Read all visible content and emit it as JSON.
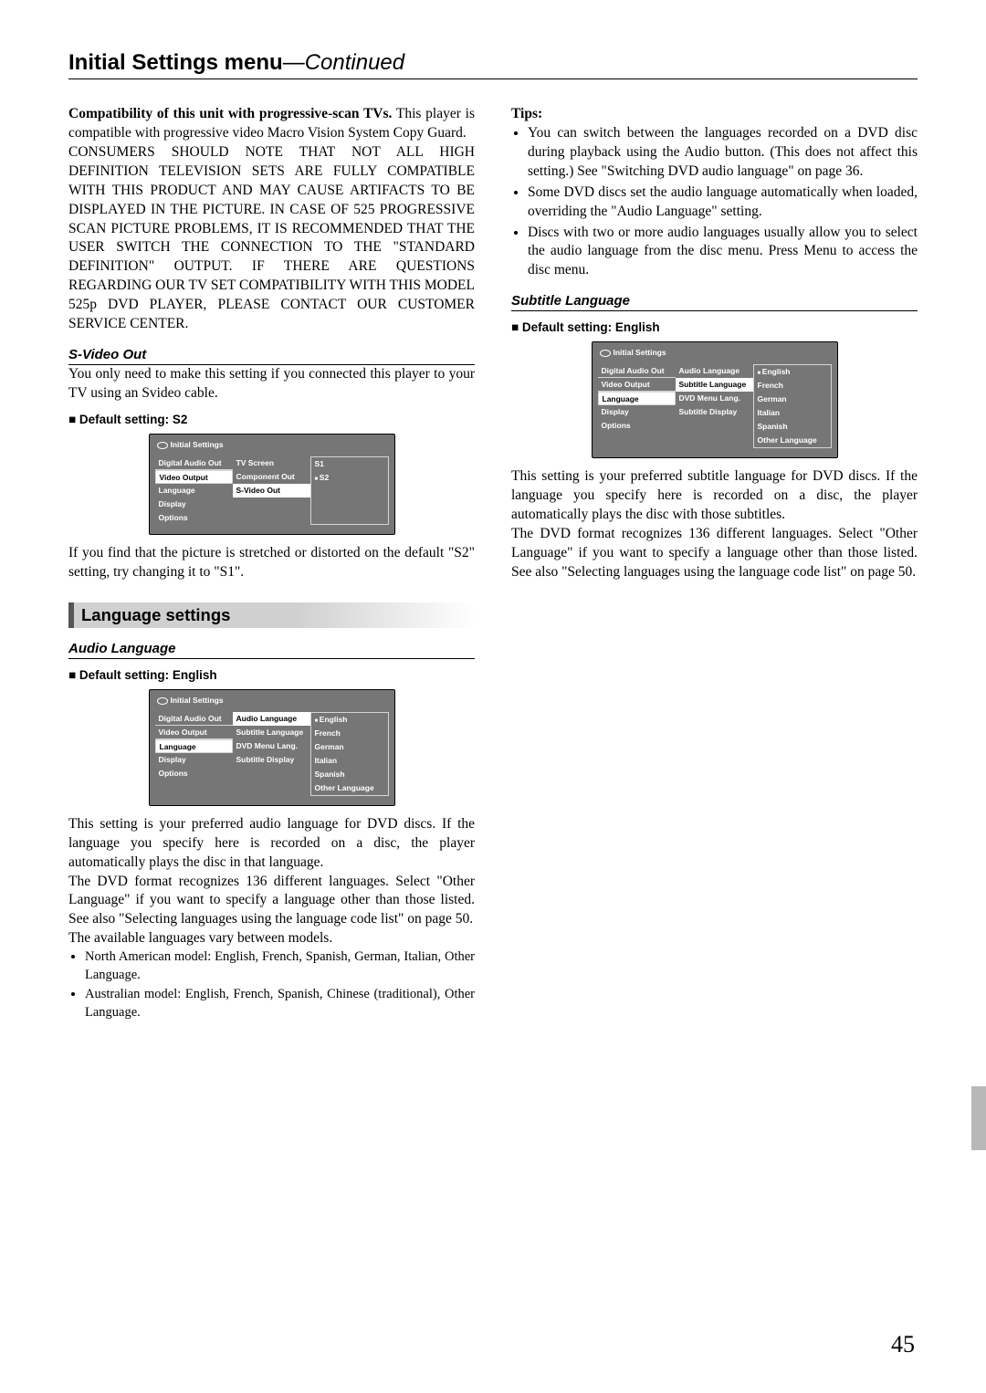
{
  "page": {
    "title_main": "Initial Settings menu",
    "title_cont": "—Continued",
    "number": "45"
  },
  "left": {
    "compat_heading": "Compatibility of this unit with progressive-scan TVs.",
    "compat_p1": "This player is compatible with progressive video Macro Vision System Copy Guard.",
    "compat_p2": "CONSUMERS SHOULD NOTE THAT NOT ALL HIGH DEFINITION TELEVISION SETS ARE FULLY COMPATIBLE WITH THIS PRODUCT AND MAY CAUSE ARTIFACTS TO BE DISPLAYED IN THE PICTURE. IN CASE OF 525 PROGRESSIVE SCAN PICTURE PROBLEMS, IT IS RECOMMENDED THAT THE USER SWITCH THE CONNECTION TO THE \"STANDARD DEFINITION\" OUTPUT. IF THERE ARE QUESTIONS REGARDING OUR TV SET COMPATIBILITY WITH THIS MODEL 525p DVD PLAYER, PLEASE CONTACT OUR CUSTOMER SERVICE CENTER.",
    "svideo": {
      "heading": "S-Video Out",
      "p1": "You only need to make this setting if you connected this player to your TV using an Svideo cable.",
      "default": "Default setting: S2",
      "p2": "If you find that the picture is stretched or distorted on the default \"S2\" setting, try changing it to \"S1\"."
    },
    "lang_section": "Language settings",
    "audio": {
      "heading": "Audio Language",
      "default": "Default setting: English",
      "p1": "This setting is your preferred audio language for DVD discs. If the language you specify here is recorded on a disc, the player automatically plays the disc in that language.",
      "p2": "The DVD format recognizes 136 different languages. Select \"Other Language\" if you want to specify a language other than those listed. See also \"Selecting languages using the language code list\" on page 50.",
      "p3": "The available languages vary between models.",
      "li1": "North American model: English, French, Spanish, German, Italian, Other Language.",
      "li2": "Australian model: English, French, Spanish, Chinese (traditional), Other Language."
    }
  },
  "right": {
    "tips_label": "Tips:",
    "tip1": "You can switch between the languages recorded on a DVD disc during playback using the Audio button. (This does not affect this setting.) See \"Switching DVD audio language\" on page 36.",
    "tip2": "Some DVD discs set the audio language automatically when loaded, overriding the \"Audio Language\" setting.",
    "tip3": "Discs with two or more audio languages usually allow you to select the audio language from the disc menu. Press Menu to access the disc menu.",
    "subtitle": {
      "heading": "Subtitle Language",
      "default": "Default setting: English",
      "p1": "This setting is your preferred subtitle language for DVD discs. If the language you specify here is recorded on a disc, the player automatically plays the disc with those subtitles.",
      "p2": "The DVD format recognizes 136 different languages. Select \"Other Language\" if you want to specify a language other than those listed. See also \"Selecting languages using the language code list\" on page 50."
    }
  },
  "menu": {
    "title": "Initial Settings",
    "left_items": [
      "Digital Audio Out",
      "Video Output",
      "Language",
      "Display",
      "Options"
    ],
    "svideo": {
      "mid": [
        "TV Screen",
        "Component Out",
        "S-Video Out"
      ],
      "right": [
        "S1",
        "S2"
      ]
    },
    "audio": {
      "mid": [
        "Audio Language",
        "Subtitle Language",
        "DVD Menu Lang.",
        "Subtitle Display"
      ],
      "right": [
        "English",
        "French",
        "German",
        "Italian",
        "Spanish",
        "Other Language"
      ]
    },
    "subtitle": {
      "mid": [
        "Audio Language",
        "Subtitle Language",
        "DVD Menu Lang.",
        "Subtitle Display"
      ],
      "right": [
        "English",
        "French",
        "German",
        "Italian",
        "Spanish",
        "Other Language"
      ]
    }
  }
}
